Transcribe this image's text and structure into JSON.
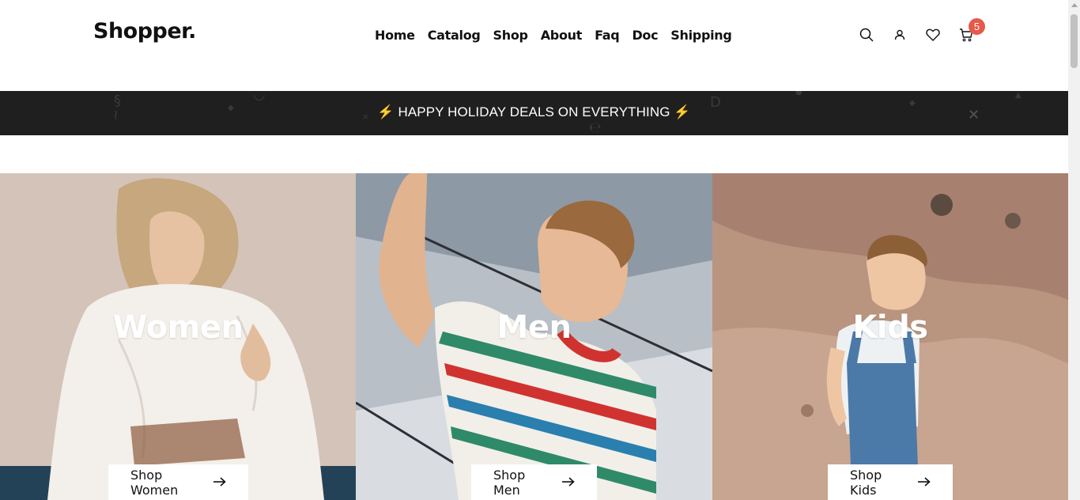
{
  "header": {
    "logo": "Shopper.",
    "nav": [
      "Home",
      "Catalog",
      "Shop",
      "About",
      "Faq",
      "Doc",
      "Shipping"
    ],
    "cart_count": "5"
  },
  "promo": {
    "text": "⚡️ HAPPY HOLIDAY DEALS ON EVERYTHING ⚡️"
  },
  "tiles": [
    {
      "title": "Women",
      "button": "Shop Women"
    },
    {
      "title": "Men",
      "button": "Shop Men"
    },
    {
      "title": "Kids",
      "button": "Shop Kids"
    }
  ],
  "colors": {
    "badge": "#e7594a",
    "promo_bg": "#1f1f1f"
  }
}
